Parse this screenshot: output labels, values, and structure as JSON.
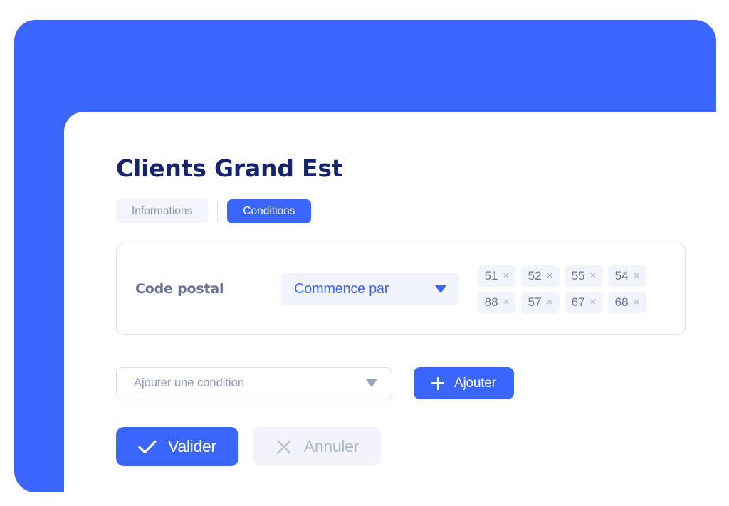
{
  "theme": {
    "brand_blue": "#3B66FC",
    "title_navy": "#16246E",
    "muted_slate": "#69719B",
    "light_lavender": "#F2F4FC",
    "card_border": "#DEE2F0"
  },
  "page": {
    "title": "Clients Grand Est"
  },
  "tabs": [
    {
      "label": "Informations",
      "active": false
    },
    {
      "label": "Conditions",
      "active": true
    }
  ],
  "conditions": [
    {
      "field_label": "Code postal",
      "operator": "Commence par",
      "operator_caret": "chevron-down-icon",
      "values": [
        {
          "label": "51",
          "remove": "×"
        },
        {
          "label": "52",
          "remove": "×"
        },
        {
          "label": "55",
          "remove": "×"
        },
        {
          "label": "54",
          "remove": "×"
        },
        {
          "label": "88",
          "remove": "×"
        },
        {
          "label": "57",
          "remove": "×"
        },
        {
          "label": "67",
          "remove": "×"
        },
        {
          "label": "68",
          "remove": "×"
        }
      ]
    }
  ],
  "add_row": {
    "select_placeholder": "Ajouter une condition",
    "select_value": "",
    "add_label": "Ajouter",
    "add_icon": "plus-icon"
  },
  "actions": {
    "validate_label": "Valider",
    "validate_icon": "check-icon",
    "cancel_label": "Annuler",
    "cancel_icon": "close-icon"
  }
}
